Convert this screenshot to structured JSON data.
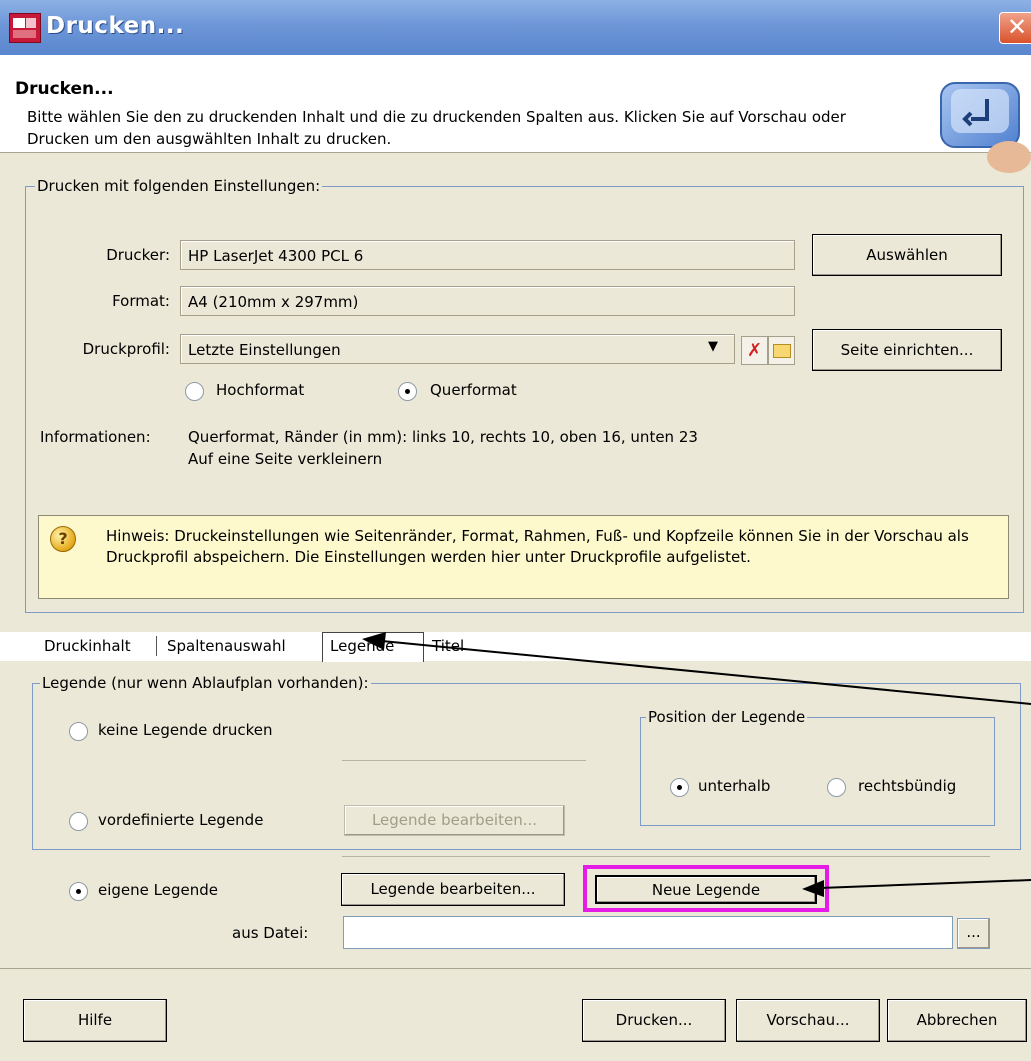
{
  "window": {
    "title": "Drucken..."
  },
  "header": {
    "title": "Drucken...",
    "description": "Bitte wählen Sie den zu druckenden Inhalt und die zu druckenden Spalten aus. Klicken Sie auf Vorschau oder Drucken um den ausgwählten Inhalt zu drucken."
  },
  "settings": {
    "group_label": "Drucken mit folgenden Einstellungen:",
    "printer_label": "Drucker:",
    "printer_value": "HP LaserJet 4300 PCL 6",
    "choose_button": "Auswählen",
    "format_label": "Format:",
    "format_value": "A4 (210mm x 297mm)",
    "profile_label": "Druckprofil:",
    "profile_value": "Letzte Einstellungen",
    "page_setup_button": "Seite einrichten...",
    "orientation": {
      "portrait_label": "Hochformat",
      "landscape_label": "Querformat",
      "selected": "landscape"
    },
    "info_label": "Informationen:",
    "info_line1": "Querformat, Ränder (in mm): links 10, rechts 10, oben 16, unten 23",
    "info_line2": "Auf eine Seite verkleinern",
    "hint": "Hinweis: Druckeinstellungen wie Seitenränder, Format, Rahmen, Fuß- und Kopfzeile können Sie in der Vorschau als Druckprofil abspeichern. Die Einstellungen werden hier unter Druckprofile aufgelistet."
  },
  "tabs": [
    {
      "label": "Druckinhalt"
    },
    {
      "label": "Spaltenauswahl"
    },
    {
      "label": "Legende",
      "active": true
    },
    {
      "label": "Titel"
    }
  ],
  "legend": {
    "group_label": "Legende (nur wenn Ablaufplan vorhanden):",
    "none_label": "keine Legende drucken",
    "predefined_label": "vordefinierte Legende",
    "predefined_edit_button": "Legende bearbeiten...",
    "own_label": "eigene Legende",
    "own_edit_button": "Legende bearbeiten...",
    "new_button": "Neue Legende",
    "file_label": "aus Datei:",
    "file_value": "",
    "browse_button": "...",
    "selected": "own",
    "position": {
      "group_label": "Position der Legende",
      "below_label": "unterhalb",
      "right_label": "rechtsbündig",
      "selected": "below"
    }
  },
  "footer": {
    "help_button": "Hilfe",
    "print_button": "Drucken...",
    "preview_button": "Vorschau...",
    "cancel_button": "Abbrechen"
  },
  "colors": {
    "titlebar": "#6e97d8",
    "dialog_bg": "#ebe8d7",
    "hint_bg": "#fdf9cc",
    "highlight": "#e41ce6",
    "group_border": "#7d9ac9"
  }
}
